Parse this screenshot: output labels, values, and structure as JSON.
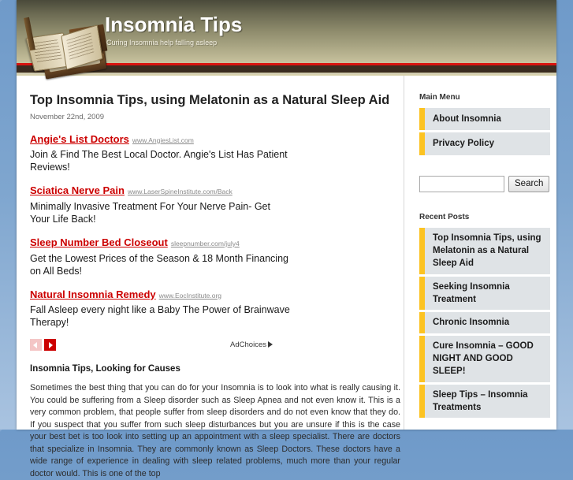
{
  "site": {
    "title": "Insomnia Tips",
    "tagline": "Curing Insomnia help falling asleep"
  },
  "post": {
    "title": "Top Insomnia Tips, using Melatonin as a Natural Sleep Aid",
    "date": "November 22nd, 2009",
    "subheading": "Insomnia Tips, Looking for Causes",
    "body": "Sometimes the best thing that you can do for your Insomnia is to look into what is really causing it. You could be suffering from a Sleep disorder such as Sleep Apnea and not even know it. This is a very common problem, that people suffer from sleep disorders and do not even know that they do. If you suspect that you suffer from such sleep disturbances but you are unsure if this is the case your best bet is too look into setting up an appointment with a sleep specialist. There are doctors that specialize in Insomnia. They are commonly known as Sleep Doctors. These doctors have a wide range of experience in dealing with sleep related problems, much more than your regular doctor would. This is one of the top"
  },
  "ads": {
    "items": [
      {
        "title": "Angie's List Doctors",
        "url": "www.AngiesList.com",
        "description": "Join & Find The Best Local Doctor. Angie's List Has Patient Reviews!"
      },
      {
        "title": "Sciatica Nerve Pain",
        "url": "www.LaserSpineInstitute.com/Back",
        "description": "Minimally Invasive Treatment For Your Nerve Pain- Get Your Life Back!"
      },
      {
        "title": "Sleep Number Bed Closeout",
        "url": "sleepnumber.com/july4",
        "description": "Get the Lowest Prices of the Season & 18 Month Financing on All Beds!"
      },
      {
        "title": "Natural Insomnia Remedy",
        "url": "www.EocInstitute.org",
        "description": "Fall Asleep every night like a Baby The Power of Brainwave Therapy!"
      }
    ],
    "adchoices_label": "AdChoices",
    "prev_label": "‹",
    "next_label": "›"
  },
  "sidebar": {
    "main_menu_heading": "Main Menu",
    "menu_items": [
      {
        "label": "About Insomnia"
      },
      {
        "label": "Privacy Policy"
      }
    ],
    "search": {
      "value": "",
      "placeholder": "",
      "button_label": "Search"
    },
    "recent_posts_heading": "Recent Posts",
    "recent_posts": [
      {
        "label": "Top Insomnia Tips, using Melatonin as a Natural Sleep Aid"
      },
      {
        "label": "Seeking Insomnia Treatment"
      },
      {
        "label": "Chronic Insomnia"
      },
      {
        "label": "Cure Insomnia – GOOD NIGHT AND GOOD SLEEP!"
      },
      {
        "label": "Sleep Tips – Insomnia Treatments"
      }
    ]
  },
  "colors": {
    "accent_yellow": "#fcc322",
    "ad_red": "#cc0000",
    "header_red": "#d8130f",
    "sidebar_item_bg": "#dfe3e6",
    "page_bg_blue": "#7ea3cd"
  }
}
